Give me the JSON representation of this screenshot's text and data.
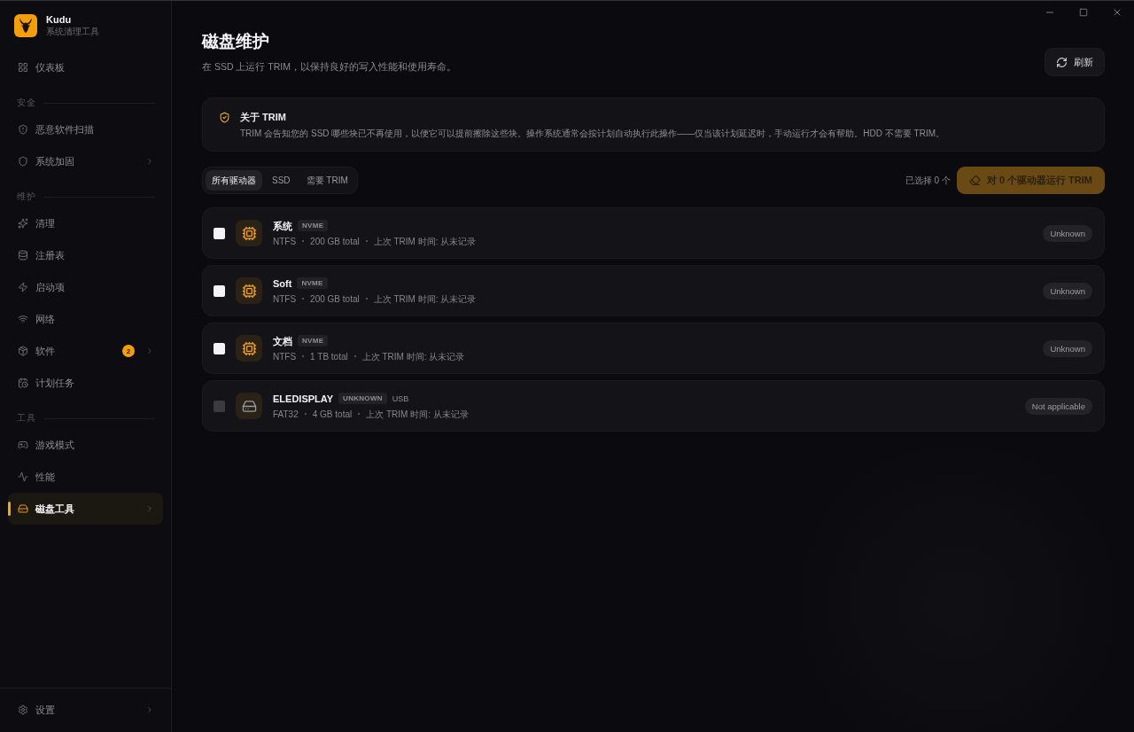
{
  "app": {
    "name": "Kudu",
    "tagline": "系统清理工具"
  },
  "sidebar": {
    "sections": [
      {
        "items": [
          {
            "label": "仪表板",
            "selected": false,
            "has_submenu": false
          }
        ]
      },
      {
        "title": "安全",
        "items": [
          {
            "label": "恶意软件扫描",
            "selected": false,
            "has_submenu": false
          },
          {
            "label": "系统加固",
            "selected": false,
            "has_submenu": true
          }
        ]
      },
      {
        "title": "维护",
        "items": [
          {
            "label": "清理",
            "selected": false,
            "has_submenu": false
          },
          {
            "label": "注册表",
            "selected": false,
            "has_submenu": false
          },
          {
            "label": "启动项",
            "selected": false,
            "has_submenu": false
          },
          {
            "label": "网络",
            "selected": false,
            "has_submenu": false
          },
          {
            "label": "软件",
            "selected": false,
            "has_submenu": true,
            "badge": "2"
          },
          {
            "label": "计划任务",
            "selected": false,
            "has_submenu": false
          }
        ]
      },
      {
        "title": "工具",
        "items": [
          {
            "label": "游戏模式",
            "selected": false,
            "has_submenu": false
          },
          {
            "label": "性能",
            "selected": false,
            "has_submenu": false
          },
          {
            "label": "磁盘工具",
            "selected": true,
            "has_submenu": true
          }
        ]
      }
    ],
    "footer": {
      "label": "设置",
      "selected": false,
      "has_submenu": true
    }
  },
  "page": {
    "title": "磁盘维护",
    "subtitle": "在 SSD 上运行 TRIM，以保持良好的写入性能和使用寿命。",
    "refresh_button": "刷新"
  },
  "info": {
    "title": "关于 TRIM",
    "body": "TRIM 会告知您的 SSD 哪些块已不再使用，以便它可以提前擦除这些块。操作系统通常会按计划自动执行此操作——仅当该计划延迟时，手动运行才会有帮助。HDD 不需要 TRIM。"
  },
  "filters": [
    {
      "label": "所有驱动器",
      "selected": true
    },
    {
      "label": "SSD",
      "selected": false
    },
    {
      "label": "需要 TRIM",
      "selected": false
    }
  ],
  "selection": {
    "count_label": "已选择 0 个",
    "run_button": {
      "label": "对 0 个驱动器运行 TRIM",
      "disabled": true
    }
  },
  "drives": [
    {
      "kind": "ssd",
      "name": "系统",
      "tag": "NVME",
      "checked": false,
      "disabled": false,
      "meta": [
        "NTFS",
        "200 GB total",
        "上次 TRIM 时间: 从未记录"
      ],
      "status": "Unknown"
    },
    {
      "kind": "ssd",
      "name": "Soft",
      "tag": "NVME",
      "checked": false,
      "disabled": false,
      "meta": [
        "NTFS",
        "200 GB total",
        "上次 TRIM 时间: 从未记录"
      ],
      "status": "Unknown"
    },
    {
      "kind": "ssd",
      "name": "文档",
      "tag": "NVME",
      "checked": false,
      "disabled": false,
      "meta": [
        "NTFS",
        "1 TB total",
        "上次 TRIM 时间: 从未记录"
      ],
      "status": "Unknown"
    },
    {
      "kind": "removable",
      "name": "ELEDISPLAY",
      "tag": "UNKNOWN",
      "connection": "USB",
      "checked": false,
      "disabled": true,
      "meta": [
        "FAT32",
        "4 GB total",
        "上次 TRIM 时间: 从未记录"
      ],
      "status": "Not applicable"
    }
  ]
}
